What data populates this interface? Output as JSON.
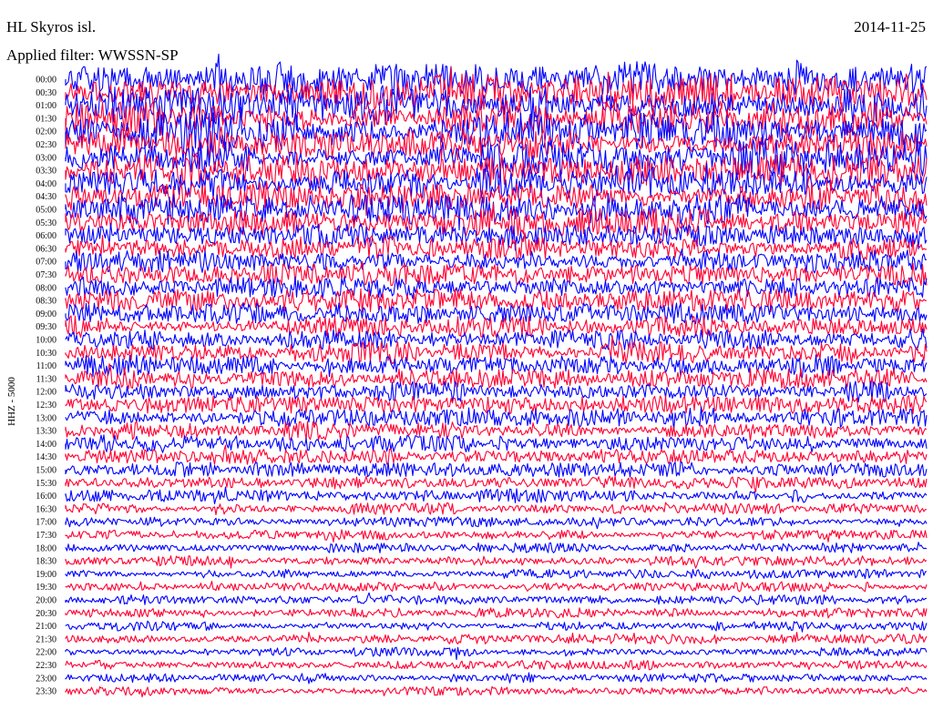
{
  "header": {
    "station": "HL Skyros isl.",
    "date": "2014-11-25",
    "filter_prefix": "Applied filter: ",
    "filter_name": "WWSSN-SP"
  },
  "chart_data": {
    "type": "line",
    "title": "HL Skyros isl.",
    "date": "2014-11-25",
    "ylabel": "HHZ - 5000",
    "row_labels": [
      "00:00",
      "00:30",
      "01:00",
      "01:30",
      "02:00",
      "02:30",
      "03:00",
      "03:30",
      "04:00",
      "04:30",
      "05:00",
      "05:30",
      "06:00",
      "06:30",
      "07:00",
      "07:30",
      "08:00",
      "08:30",
      "09:00",
      "09:30",
      "10:00",
      "10:30",
      "11:00",
      "11:30",
      "12:00",
      "12:30",
      "13:00",
      "13:30",
      "14:00",
      "14:30",
      "15:00",
      "15:30",
      "16:00",
      "16:30",
      "17:00",
      "17:30",
      "18:00",
      "18:30",
      "19:00",
      "19:30",
      "20:00",
      "20:30",
      "21:00",
      "21:30",
      "22:00",
      "22:30",
      "23:00",
      "23:30"
    ],
    "row_color_cycle": [
      "#0000ff",
      "#ff0033"
    ],
    "relative_noise_amplitude": [
      1.55,
      1.6,
      1.6,
      1.55,
      1.5,
      1.5,
      1.45,
      1.4,
      1.35,
      1.3,
      1.2,
      1.15,
      1.1,
      1.05,
      1.0,
      1.0,
      0.95,
      0.95,
      0.95,
      0.9,
      0.9,
      0.9,
      0.85,
      0.85,
      0.85,
      0.8,
      0.8,
      0.75,
      0.7,
      0.65,
      0.6,
      0.55,
      0.55,
      0.5,
      0.45,
      0.42,
      0.42,
      0.42,
      0.42,
      0.4,
      0.4,
      0.4,
      0.4,
      0.4,
      0.38,
      0.38,
      0.38,
      0.38
    ],
    "grid": false,
    "legend": "none"
  }
}
